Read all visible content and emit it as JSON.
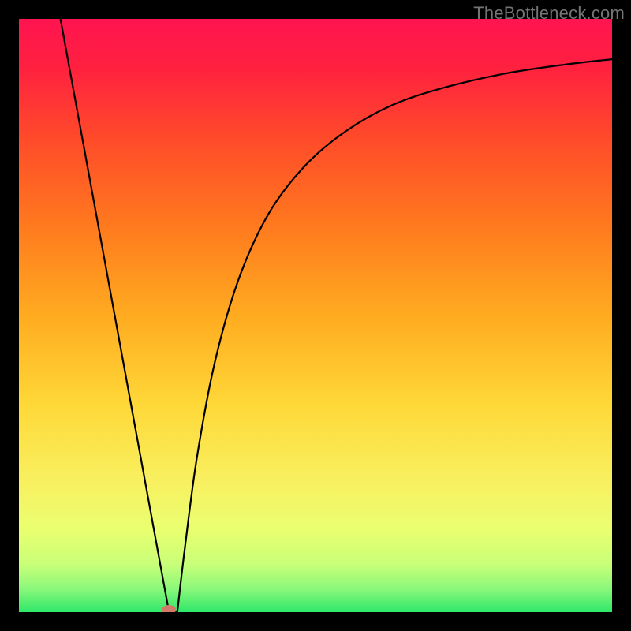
{
  "watermark": "TheBottleneck.com",
  "chart_data": {
    "type": "line",
    "title": "",
    "xlabel": "",
    "ylabel": "",
    "xlim": [
      0,
      100
    ],
    "ylim": [
      0,
      100
    ],
    "grid": false,
    "legend": false,
    "gradient_stops": [
      {
        "offset": 0.0,
        "color": "#ff1450"
      },
      {
        "offset": 0.08,
        "color": "#ff2040"
      },
      {
        "offset": 0.2,
        "color": "#ff4a2a"
      },
      {
        "offset": 0.35,
        "color": "#ff7a1e"
      },
      {
        "offset": 0.5,
        "color": "#ffab20"
      },
      {
        "offset": 0.65,
        "color": "#ffd838"
      },
      {
        "offset": 0.78,
        "color": "#f8f060"
      },
      {
        "offset": 0.86,
        "color": "#eaff70"
      },
      {
        "offset": 0.92,
        "color": "#c8ff78"
      },
      {
        "offset": 0.96,
        "color": "#8cf87a"
      },
      {
        "offset": 1.0,
        "color": "#2ee86a"
      }
    ],
    "series": [
      {
        "name": "curve",
        "x": [
          7.0,
          12.0,
          17.0,
          21.0,
          24.0,
          25.3,
          26.0,
          26.7,
          28.0,
          30.0,
          33.0,
          37.0,
          42.0,
          48.0,
          55.0,
          63.0,
          72.0,
          82.0,
          92.0,
          100.0
        ],
        "y": [
          100.0,
          78.2,
          56.4,
          39.0,
          16.0,
          0.0,
          0.0,
          0.0,
          11.0,
          26.0,
          42.0,
          56.0,
          67.0,
          75.0,
          81.0,
          85.5,
          88.5,
          90.8,
          92.3,
          93.2
        ]
      }
    ],
    "marker": {
      "x": 25.3,
      "y": 0.0,
      "rx": 9,
      "ry": 6,
      "fill": "#d47a6a"
    }
  }
}
